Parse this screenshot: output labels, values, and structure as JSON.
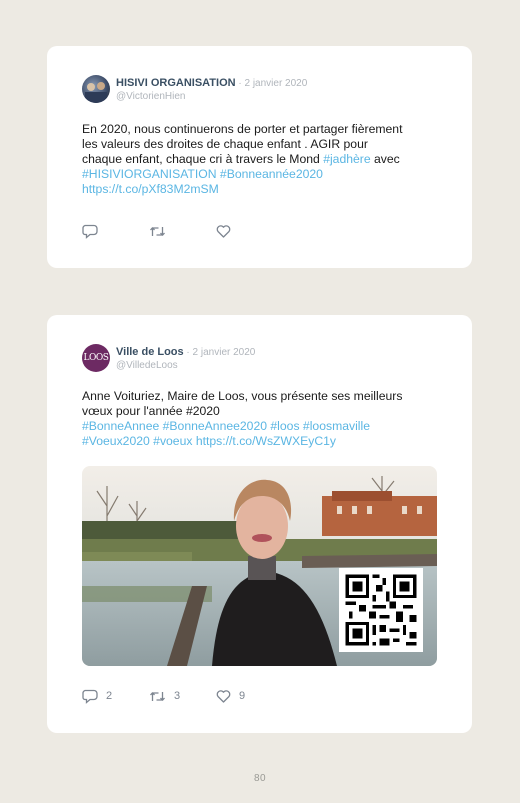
{
  "tweets": [
    {
      "author": "HISIVI ORGANISATION",
      "date": " · 2 janvier 2020",
      "handle": "@VictorienHien",
      "text_lines": [
        "En 2020, nous continuerons de porter et partager fièrement",
        "les valeurs des droites de chaque enfant . AGIR pour",
        "chaque enfant, chaque cri à travers le Mond "
      ],
      "hashtag_inline": "#jadhère",
      "text_after_inline": " avec",
      "link_line_1": "#HISIVIORGANISATION #Bonneannée2020",
      "link_line_2": "https://t.co/pXf83M2mSM",
      "counts": {
        "reply": "",
        "retweet": "",
        "like": ""
      }
    },
    {
      "author": "Ville de Loos",
      "date": " · 2 janvier 2020",
      "handle": "@VilledeLoos",
      "avatar_text": "LOOS",
      "text_lines": [
        "Anne Voituriez, Maire de Loos, vous présente ses meilleurs",
        "vœux pour l'année #2020"
      ],
      "link_line_1": "#BonneAnnee #BonneAnnee2020 #loos #loosmaville",
      "link_line_2": "#Voeux2020 #voeux https://t.co/WsZWXEyC1y",
      "counts": {
        "reply": "2",
        "retweet": "3",
        "like": "9"
      }
    }
  ],
  "icons": [
    "reply-icon",
    "retweet-icon",
    "like-icon",
    "qr-code"
  ],
  "colors": {
    "background": "#edeae3",
    "link": "#5bb6e3",
    "name": "#3a4f63"
  },
  "page_number": "80"
}
